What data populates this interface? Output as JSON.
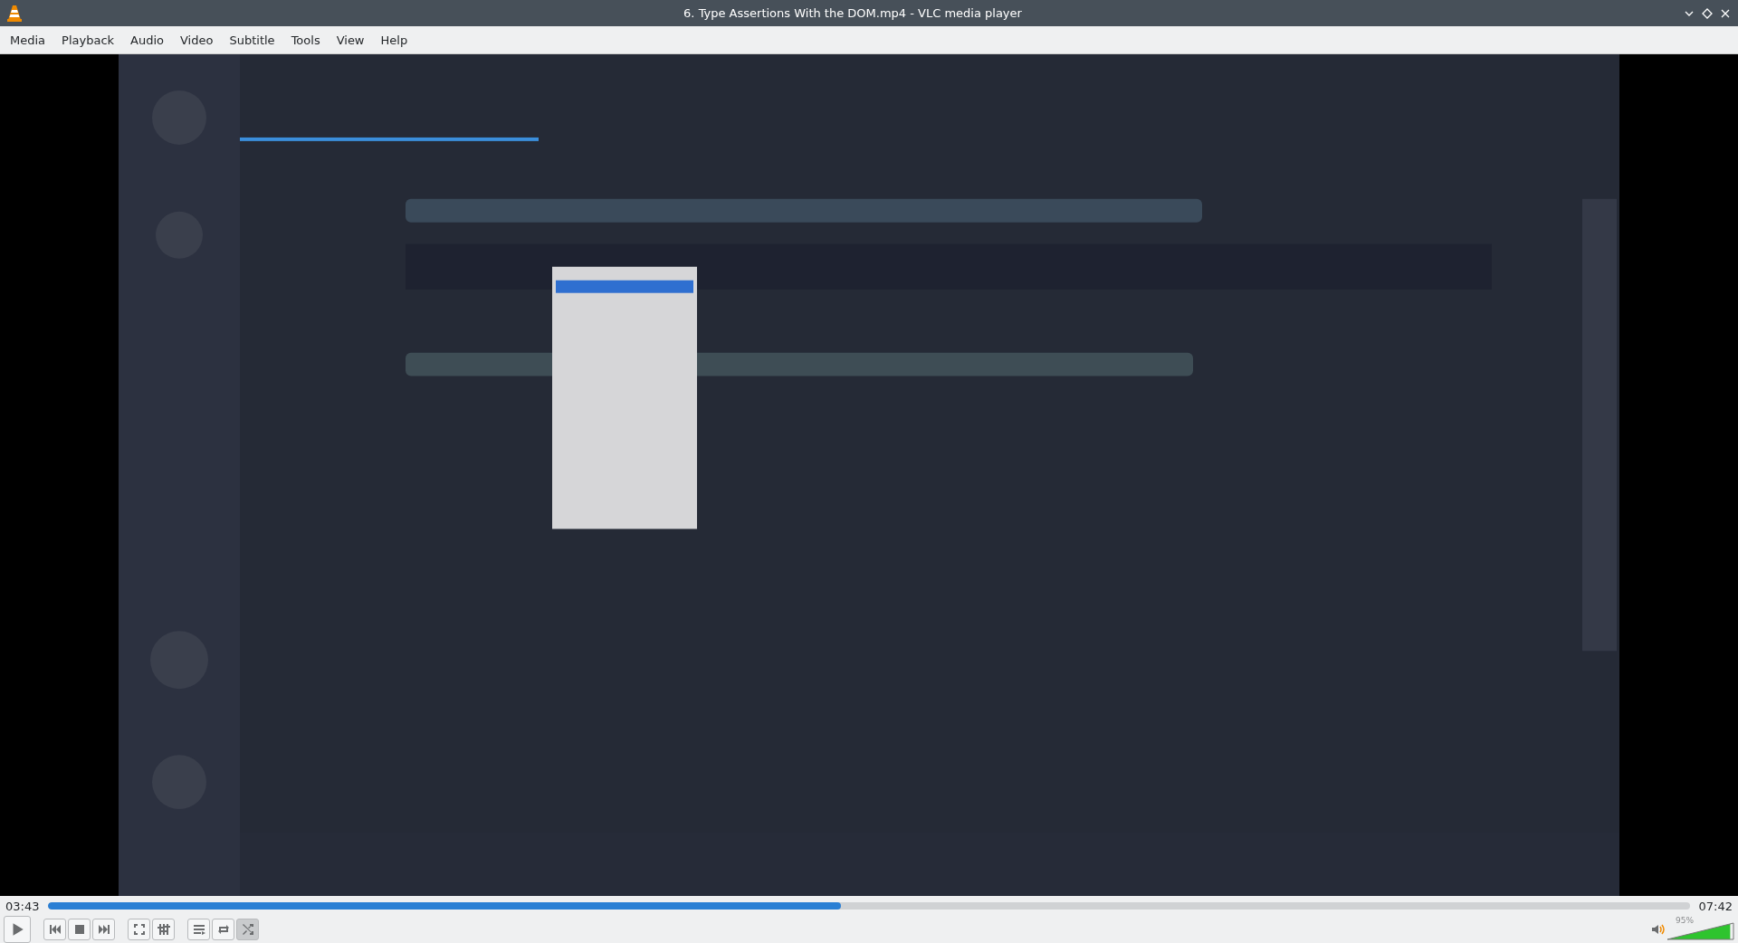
{
  "window": {
    "title": "6. Type Assertions With the DOM.mp4 - VLC media player"
  },
  "menu": [
    "Media",
    "Playback",
    "Audio",
    "Video",
    "Subtitle",
    "Tools",
    "View",
    "Help"
  ],
  "seek": {
    "elapsed": "03:43",
    "total": "07:42",
    "level": 0.483
  },
  "controls": [
    {
      "kind": "play"
    },
    {
      "kind": "gap"
    },
    {
      "kind": "previous"
    },
    {
      "kind": "stop"
    },
    {
      "kind": "next"
    },
    {
      "kind": "gap"
    },
    {
      "kind": "fullscreen"
    },
    {
      "kind": "settings"
    },
    {
      "kind": "gap"
    },
    {
      "kind": "playlist"
    },
    {
      "kind": "loop",
      "selected": false
    },
    {
      "kind": "shuffle",
      "selected": true
    }
  ],
  "volume": {
    "reading": "95%",
    "level": 0.95
  }
}
